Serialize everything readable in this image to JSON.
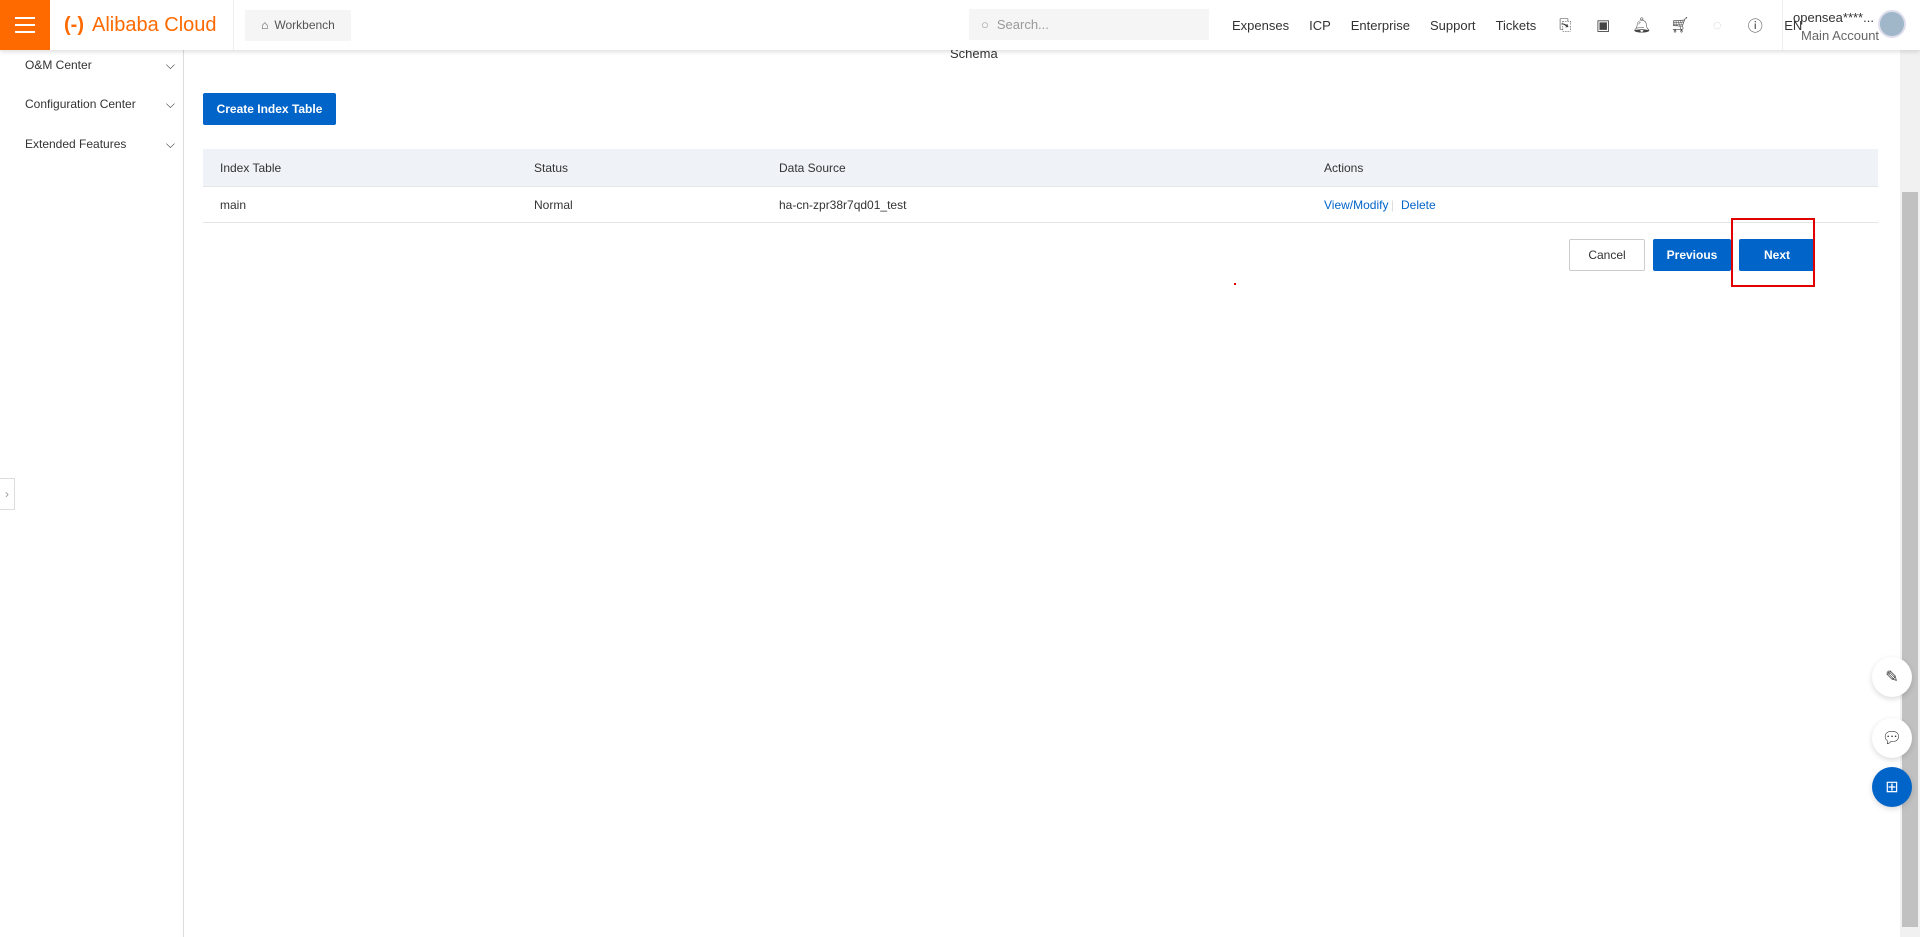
{
  "header": {
    "brand": "Alibaba Cloud",
    "workbench": "Workbench",
    "search_placeholder": "Search...",
    "nav": [
      "Expenses",
      "ICP",
      "Enterprise",
      "Support",
      "Tickets"
    ],
    "lang": "EN",
    "user_name": "opensea****...",
    "account_type": "Main Account"
  },
  "sidebar": {
    "items": [
      {
        "label": "O&M Center"
      },
      {
        "label": "Configuration Center"
      },
      {
        "label": "Extended Features"
      }
    ]
  },
  "main": {
    "step_title": "Schema",
    "create_button": "Create Index Table",
    "table": {
      "columns": [
        "Index Table",
        "Status",
        "Data Source",
        "Actions"
      ],
      "rows": [
        {
          "index_table": "main",
          "status": "Normal",
          "data_source": "ha-cn-zpr38r7qd01_test",
          "actions": [
            "View/Modify",
            "Delete"
          ]
        }
      ]
    },
    "cancel": "Cancel",
    "previous": "Previous",
    "next": "Next"
  },
  "colors": {
    "brand": "#ff6a00",
    "primary": "#0064c8",
    "highlight": "#e00000"
  }
}
